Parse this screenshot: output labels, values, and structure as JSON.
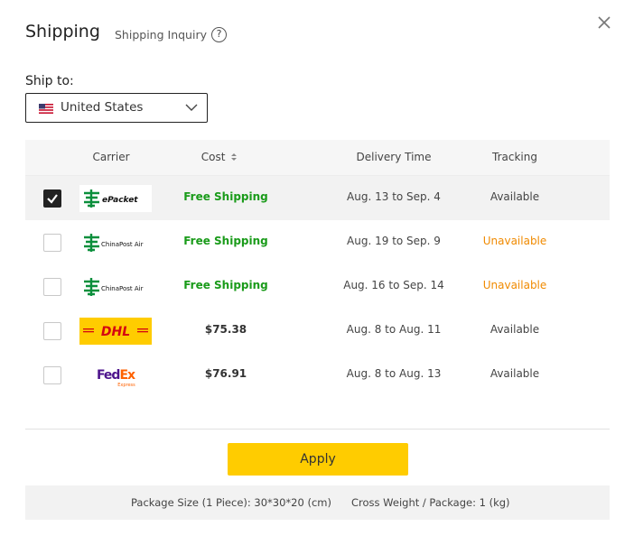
{
  "header": {
    "title": "Shipping",
    "inquiry_label": "Shipping Inquiry",
    "help_glyph": "?"
  },
  "ship_to": {
    "label": "Ship to:",
    "selected": "United States",
    "flag_icon": "us-flag-icon"
  },
  "table": {
    "columns": [
      "Carrier",
      "Cost",
      "Delivery Time",
      "Tracking"
    ],
    "sort_indicator": "sort-icon",
    "rows": [
      {
        "carrier": "ePacket",
        "logo_text": "ePacket",
        "cost": "Free Shipping",
        "delivery": "Aug. 13 to Sep. 4",
        "tracking": "Available",
        "checked": true
      },
      {
        "carrier": "China Post Air",
        "logo_text": "ChinaPost Air",
        "cost": "Free Shipping",
        "delivery": "Aug. 19 to Sep. 9",
        "tracking": "Unavailable",
        "checked": false
      },
      {
        "carrier": "China Post Air",
        "logo_text": "ChinaPost Air",
        "cost": "Free Shipping",
        "delivery": "Aug. 16 to Sep. 14",
        "tracking": "Unavailable",
        "checked": false
      },
      {
        "carrier": "DHL",
        "logo_text": "DHL",
        "cost": "$75.38",
        "delivery": "Aug. 8 to Aug. 11",
        "tracking": "Available",
        "checked": false
      },
      {
        "carrier": "FedEx",
        "logo_text": "FedEx",
        "logo_sub": "Express",
        "cost": "$76.91",
        "delivery": "Aug. 8 to Aug. 13",
        "tracking": "Available",
        "checked": false
      }
    ]
  },
  "apply_label": "Apply",
  "footer": {
    "package_size": "Package Size (1 Piece): 30*30*20 (cm)",
    "gross_weight": "Cross Weight / Package: 1 (kg)"
  },
  "colors": {
    "free": "#1a9b1a",
    "unavailable": "#f08a00",
    "apply": "#ffcc00",
    "dhl_yellow": "#ffcc00",
    "dhl_red": "#d40511",
    "fedex_purple": "#4d148c",
    "fedex_orange": "#ff6200",
    "chinapost_green": "#0b8f3c"
  }
}
